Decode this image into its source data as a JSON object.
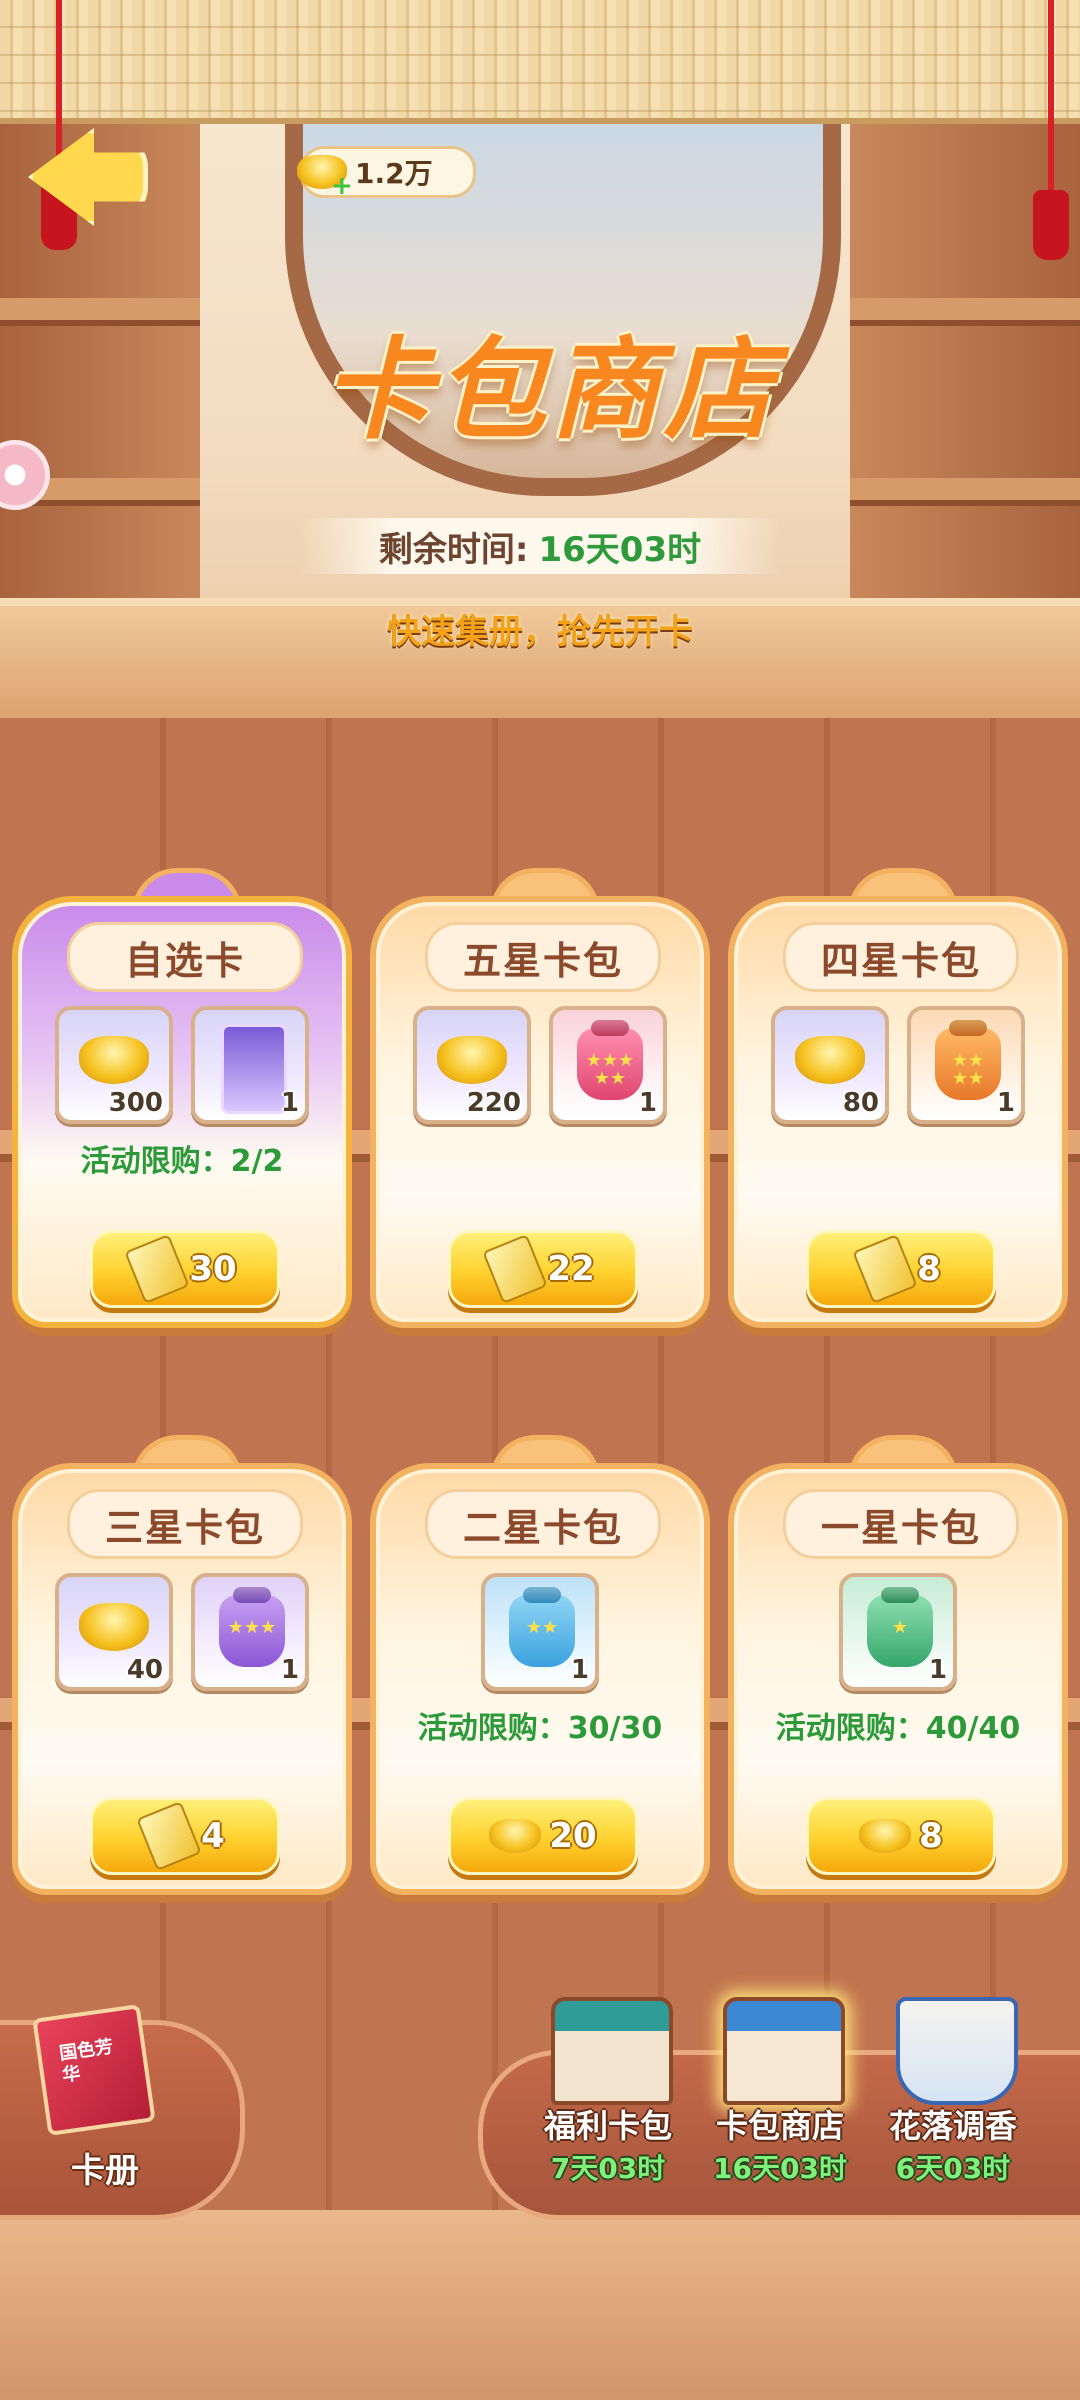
{
  "header": {
    "currency_value": "1.2万",
    "title": "卡包商店",
    "remaining_label": "剩余时间:",
    "remaining_value": "16天03时",
    "slogan": "快速集册，抢先开卡"
  },
  "cards": [
    {
      "title": "自选卡",
      "items": [
        {
          "icon": "gold-ingot-icon",
          "qty": "300"
        },
        {
          "icon": "character-card-icon",
          "qty": "1"
        }
      ],
      "limit": "活动限购：2/2",
      "price_icon": "ticket-icon",
      "price": "30"
    },
    {
      "title": "五星卡包",
      "items": [
        {
          "icon": "gold-ingot-icon",
          "qty": "220"
        },
        {
          "icon": "pink-card-pack-icon",
          "qty": "1"
        }
      ],
      "limit": "",
      "price_icon": "ticket-icon",
      "price": "22"
    },
    {
      "title": "四星卡包",
      "items": [
        {
          "icon": "gold-ingot-icon",
          "qty": "80"
        },
        {
          "icon": "orange-card-pack-icon",
          "qty": "1"
        }
      ],
      "limit": "",
      "price_icon": "ticket-icon",
      "price": "8"
    },
    {
      "title": "三星卡包",
      "items": [
        {
          "icon": "gold-ingot-icon",
          "qty": "40"
        },
        {
          "icon": "purple-card-pack-icon",
          "qty": "1"
        }
      ],
      "limit": "",
      "price_icon": "ticket-icon",
      "price": "4"
    },
    {
      "title": "二星卡包",
      "items": [
        {
          "icon": "blue-card-pack-icon",
          "qty": "1"
        }
      ],
      "limit": "活动限购：30/30",
      "price_icon": "gold-ingot-icon",
      "price": "20"
    },
    {
      "title": "一星卡包",
      "items": [
        {
          "icon": "green-card-pack-icon",
          "qty": "1"
        }
      ],
      "limit": "活动限购：40/40",
      "price_icon": "gold-ingot-icon",
      "price": "8"
    }
  ],
  "album": {
    "label": "卡册",
    "cover_text": "国色芳华"
  },
  "nav": [
    {
      "label": "福利卡包",
      "time": "7天03时",
      "icon": "welfare-pack-pavilion-icon"
    },
    {
      "label": "卡包商店",
      "time": "16天03时",
      "icon": "card-shop-pavilion-icon"
    },
    {
      "label": "花落调香",
      "time": "6天03时",
      "icon": "incense-mortar-icon"
    }
  ],
  "colors": {
    "accent_orange": "#f7871e",
    "limit_green": "#2d9a3a",
    "button_gold": "#ffd12e",
    "timer_green": "#7ff07a"
  }
}
